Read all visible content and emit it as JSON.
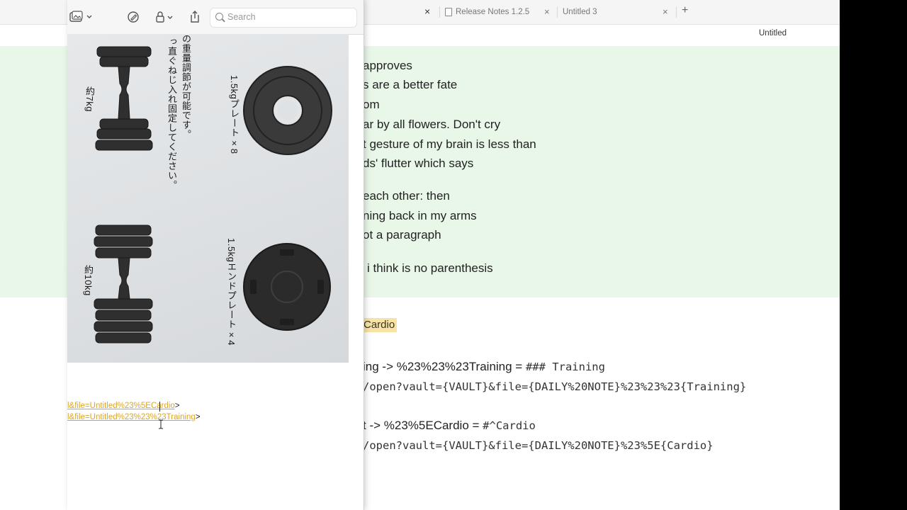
{
  "editor": {
    "tabs": [
      {
        "label": "Release Notes 1.2.5",
        "close": "×"
      },
      {
        "label": "Untitled 3",
        "close": "×"
      }
    ],
    "active_tab_close": "×",
    "new_tab": "+",
    "doc_title": "Untitled",
    "poem_lines": [
      "approves",
      "s are a better fate",
      "om",
      "ar by all flowers. Don't cry",
      "t gesture of my brain is less than",
      "ds' flutter which says",
      "each other: then",
      "ning back in my arms",
      "ot a paragraph",
      "i think is no parenthesis"
    ],
    "tag": "Cardio",
    "code": {
      "line1_prefix": "ing -> %23%23%23Training = ",
      "line1_code": "### Training",
      "line2": "/open?vault={VAULT}&file={DAILY%20NOTE}%23%23%23{Training}",
      "line3_prefix": "t -> %23%5ECardio = ",
      "line3_code": "#^Cardio",
      "line4": "/open?vault={VAULT}&file={DAILY%20NOTE}%23%5E{Cardio}"
    }
  },
  "preview": {
    "search": {
      "placeholder": "Search"
    },
    "photo_text": {
      "plate_label": "1.5kgプレート×8",
      "end_plate_label": "1.5kgエンドプレート×4",
      "weight_7": "約7kg",
      "weight_10": "約10kg",
      "note_1": "の重量調節が可能です。",
      "note_2": "っ直ぐねじ入れ固定してください。"
    },
    "links": [
      {
        "text": "l&file=Untitled%23%5ECardio",
        "suffix": ">"
      },
      {
        "text": "l&file=Untitled%23%23%23Training",
        "suffix": ">"
      }
    ]
  }
}
